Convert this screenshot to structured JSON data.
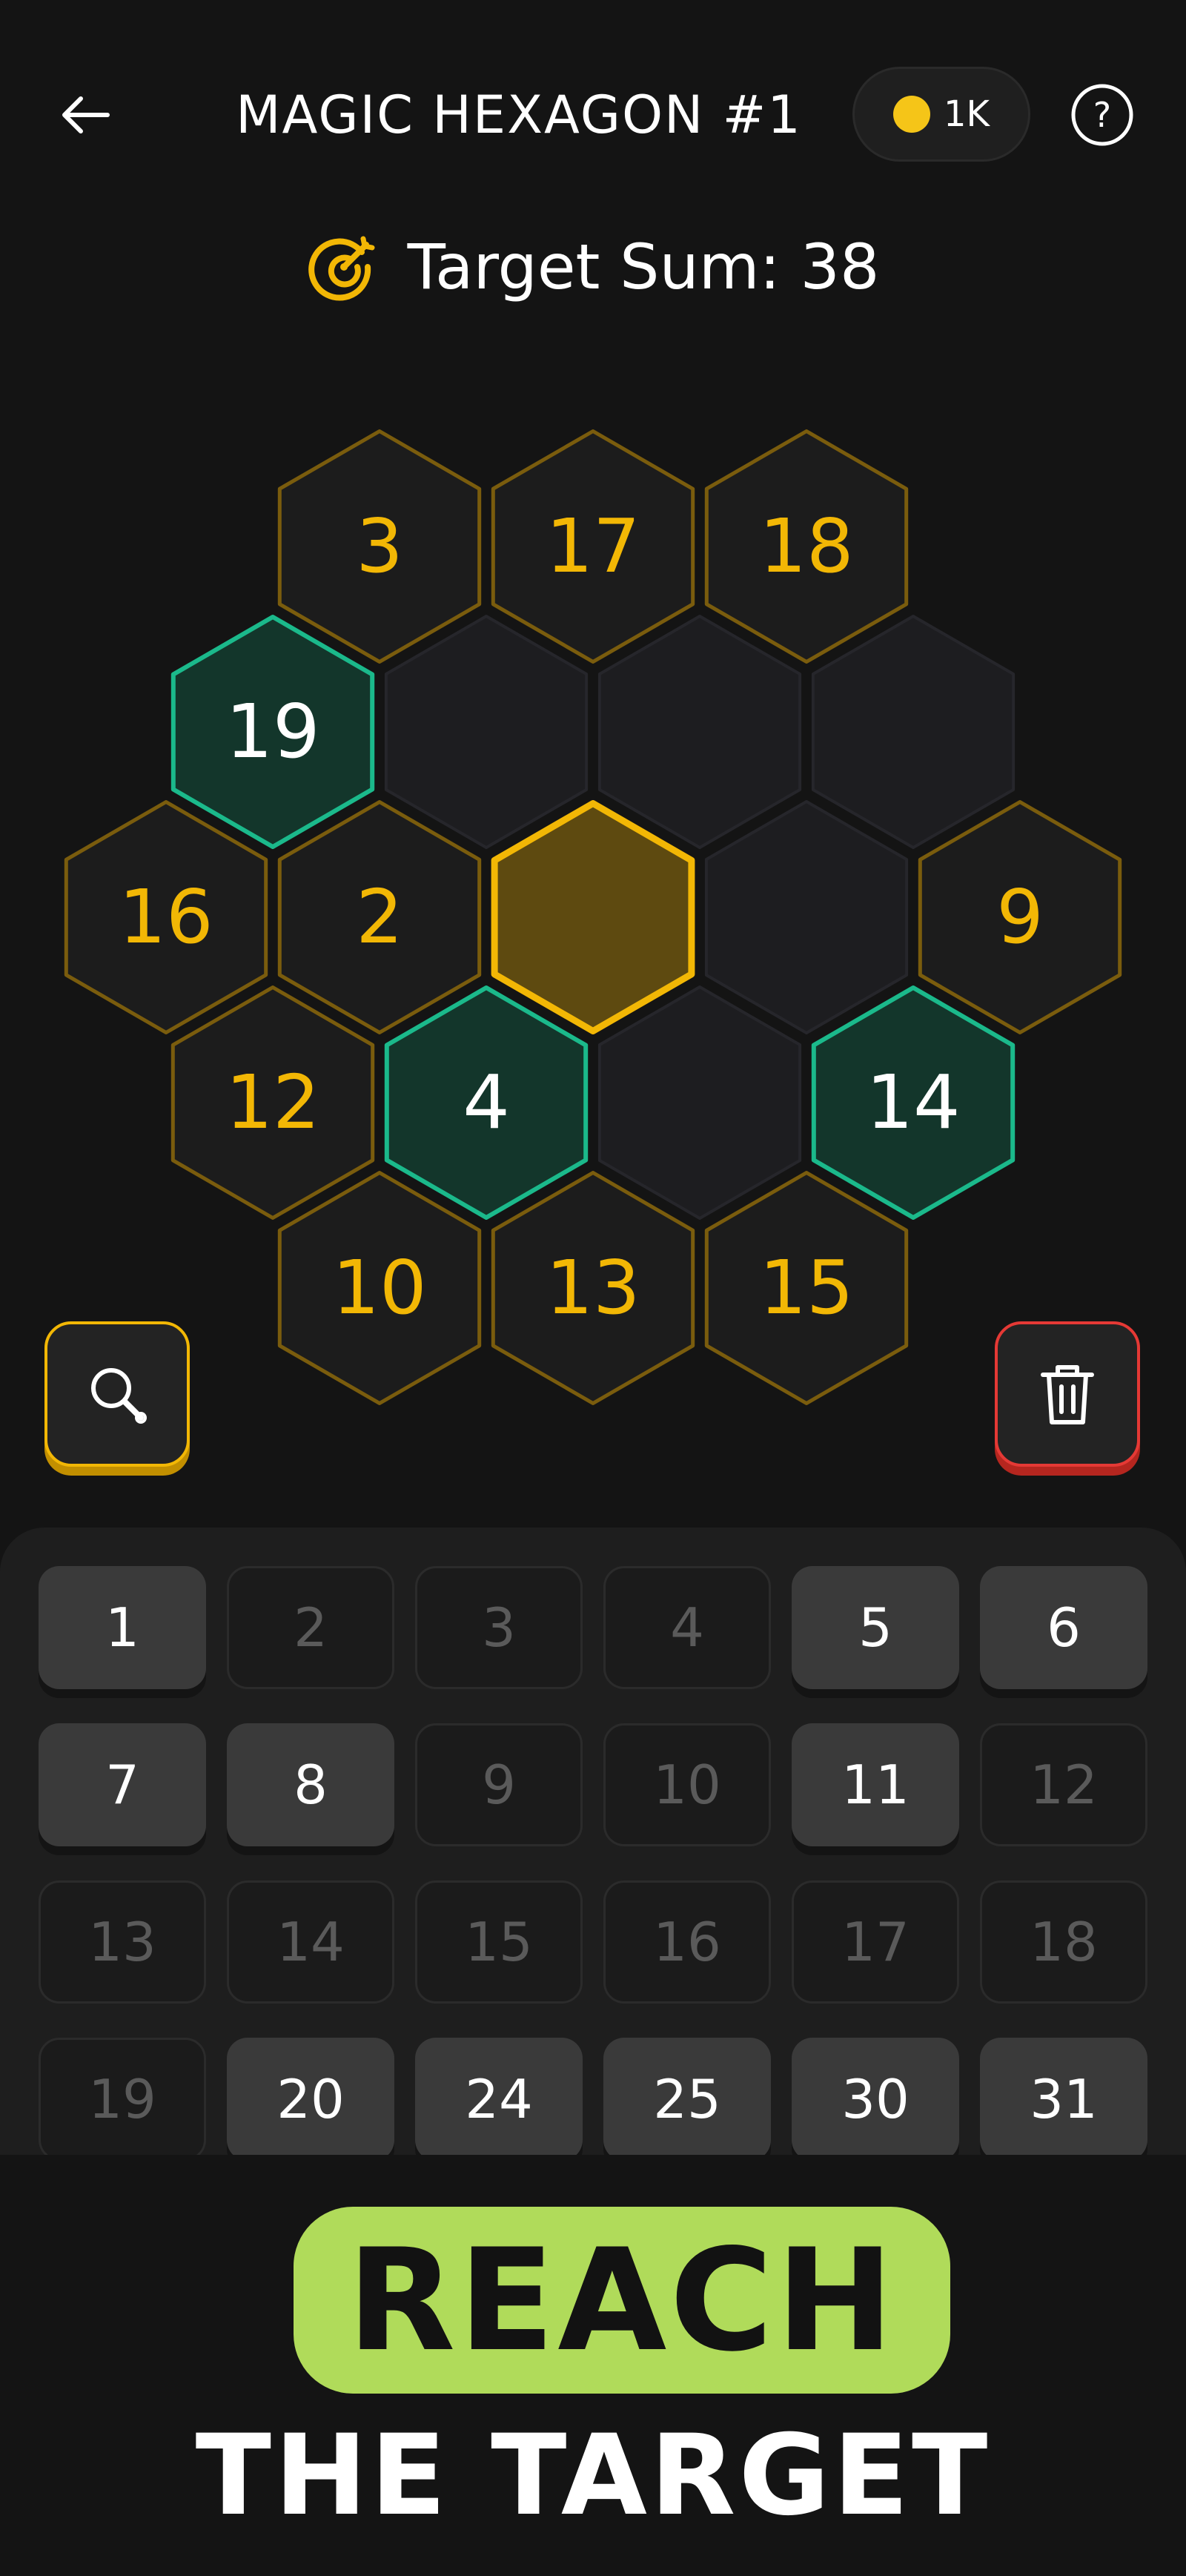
{
  "header": {
    "title": "MAGIC HEXAGON #1",
    "coins": "1K"
  },
  "target": {
    "label": "Target Sum: 38"
  },
  "colors": {
    "accent": "#f2b705",
    "correct": "#1bb98b",
    "danger": "#e53935",
    "banner": "#b0db5a"
  },
  "board": {
    "rows": [
      [
        {
          "value": "3",
          "state": "given"
        },
        {
          "value": "17",
          "state": "given"
        },
        {
          "value": "18",
          "state": "given"
        }
      ],
      [
        {
          "value": "19",
          "state": "placed"
        },
        {
          "value": "",
          "state": "empty"
        },
        {
          "value": "",
          "state": "empty"
        },
        {
          "value": "",
          "state": "empty"
        }
      ],
      [
        {
          "value": "16",
          "state": "given"
        },
        {
          "value": "2",
          "state": "given"
        },
        {
          "value": "",
          "state": "selected"
        },
        {
          "value": "",
          "state": "empty"
        },
        {
          "value": "9",
          "state": "given"
        }
      ],
      [
        {
          "value": "12",
          "state": "given"
        },
        {
          "value": "4",
          "state": "placed"
        },
        {
          "value": "",
          "state": "empty"
        },
        {
          "value": "14",
          "state": "placed"
        }
      ],
      [
        {
          "value": "10",
          "state": "given"
        },
        {
          "value": "13",
          "state": "given"
        },
        {
          "value": "15",
          "state": "given"
        }
      ]
    ]
  },
  "keypad": {
    "keys": [
      {
        "label": "1",
        "enabled": true
      },
      {
        "label": "2",
        "enabled": false
      },
      {
        "label": "3",
        "enabled": false
      },
      {
        "label": "4",
        "enabled": false
      },
      {
        "label": "5",
        "enabled": true
      },
      {
        "label": "6",
        "enabled": true
      },
      {
        "label": "7",
        "enabled": true
      },
      {
        "label": "8",
        "enabled": true
      },
      {
        "label": "9",
        "enabled": false
      },
      {
        "label": "10",
        "enabled": false
      },
      {
        "label": "11",
        "enabled": true
      },
      {
        "label": "12",
        "enabled": false
      },
      {
        "label": "13",
        "enabled": false
      },
      {
        "label": "14",
        "enabled": false
      },
      {
        "label": "15",
        "enabled": false
      },
      {
        "label": "16",
        "enabled": false
      },
      {
        "label": "17",
        "enabled": false
      },
      {
        "label": "18",
        "enabled": false
      },
      {
        "label": "19",
        "enabled": false
      },
      {
        "label": "20",
        "enabled": true
      },
      {
        "label": "24",
        "enabled": true
      },
      {
        "label": "25",
        "enabled": true
      },
      {
        "label": "30",
        "enabled": true
      },
      {
        "label": "31",
        "enabled": true
      }
    ]
  },
  "banner": {
    "line1": "REACH",
    "line2": "THE TARGET"
  },
  "icons": {
    "back": "arrow-left-icon",
    "coin": "coin-icon",
    "help": "question-circle-icon",
    "target": "target-icon",
    "hint": "magnifier-icon",
    "clear": "trash-icon"
  }
}
